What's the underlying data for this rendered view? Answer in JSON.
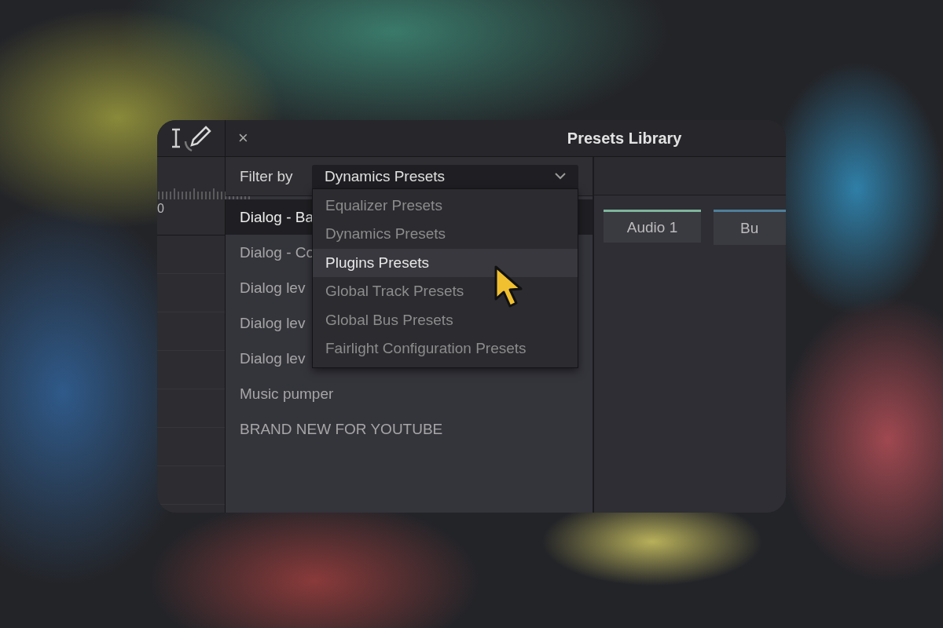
{
  "ruler": {
    "label": "0"
  },
  "header": {
    "close": "×",
    "title": "Presets Library"
  },
  "filter": {
    "label": "Filter by",
    "value": "Dynamics Presets",
    "expanded": true,
    "options": [
      {
        "label": "Equalizer Presets",
        "hovered": false
      },
      {
        "label": "Dynamics Presets",
        "hovered": false
      },
      {
        "label": "Plugins Presets",
        "hovered": true
      },
      {
        "label": "Global Track Presets",
        "hovered": false
      },
      {
        "label": "Global Bus Presets",
        "hovered": false
      },
      {
        "label": "Fairlight Configuration Presets",
        "hovered": false
      }
    ]
  },
  "presets": [
    {
      "name": "Dialog - Ba",
      "selected": true
    },
    {
      "name": "Dialog - Co",
      "selected": false
    },
    {
      "name": "Dialog lev",
      "selected": false
    },
    {
      "name": "Dialog lev",
      "selected": false
    },
    {
      "name": "Dialog lev",
      "selected": false
    },
    {
      "name": "Music pumper",
      "selected": false
    },
    {
      "name": "BRAND NEW FOR YOUTUBE",
      "selected": false
    }
  ],
  "tracks": [
    {
      "label": "Audio 1",
      "color": "#7fb59c"
    },
    {
      "label": "Bu",
      "color": "#4f7f9a"
    }
  ]
}
